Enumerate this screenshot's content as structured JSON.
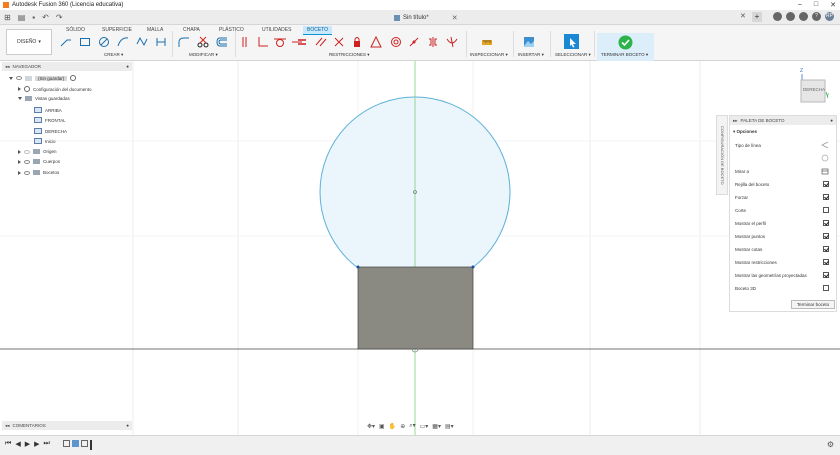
{
  "app": {
    "title": "Autodesk Fusion 360 (Licencia educativa)",
    "document_tab": "Sin título*"
  },
  "workspace": {
    "label": "DISEÑO",
    "caret": "▾"
  },
  "ribbon": {
    "tabs": [
      "SÓLIDO",
      "SUPERFICIE",
      "MALLA",
      "CHAPA",
      "PLÁSTICO",
      "UTILIDADES",
      "BOCETO"
    ],
    "active_tab": "BOCETO",
    "groups": {
      "crear": "CREAR ▾",
      "modificar": "MODIFICAR ▾",
      "restricciones": "RESTRICCIONES ▾",
      "inspeccionar": "INSPECCIONAR ▾",
      "insertar": "INSERTAR ▾",
      "seleccionar": "SELECCIONAR ▾",
      "terminar": "TERMINAR BOCETO ▾"
    }
  },
  "browser": {
    "header": "NAVEGADOR",
    "root": "(Sin guardar)",
    "doc_settings": "Configuración del documento",
    "saved_views": "Vistas guardadas",
    "views": [
      "ARRIBA",
      "FRONTAL",
      "DERECHA",
      "Inicio"
    ],
    "origin": "Origen",
    "bodies": "Cuerpos",
    "sketches": "Bocetos"
  },
  "viewcube": {
    "face": "DERECHA",
    "axis_z": "Z",
    "axis_y": "Y"
  },
  "sketch_palette": {
    "side_label": "CONFIGURACIÓN DE BOCETO",
    "title": "PALETA DE BOCETO",
    "section": "Opciones",
    "rows": [
      {
        "label": "Tipo de línea",
        "control": "line-type"
      },
      {
        "label": "",
        "control": "circle"
      },
      {
        "label": "Mirar a",
        "control": "look-at"
      },
      {
        "label": "Rejilla del boceto",
        "checked": true
      },
      {
        "label": "Forzar",
        "checked": true
      },
      {
        "label": "Corte",
        "checked": false
      },
      {
        "label": "Mostrar el perfil",
        "checked": true
      },
      {
        "label": "Mostrar puntos",
        "checked": true
      },
      {
        "label": "Mostrar cotas",
        "checked": true
      },
      {
        "label": "Mostrar restricciones",
        "checked": true
      },
      {
        "label": "Mostrar las geometrías proyectadas",
        "checked": true
      },
      {
        "label": "Boceto 3D",
        "checked": false
      }
    ],
    "finish_button": "Terminar boceto"
  },
  "comments": {
    "label": "COMENTARIOS"
  },
  "colors": {
    "accent": "#0696d7",
    "circle_fill": "#eaf5fc",
    "circle_stroke": "#5fb1d8",
    "rect_fill": "#8a8a82",
    "axis_green": "#7fd07f",
    "finish_green": "#2db34a"
  }
}
